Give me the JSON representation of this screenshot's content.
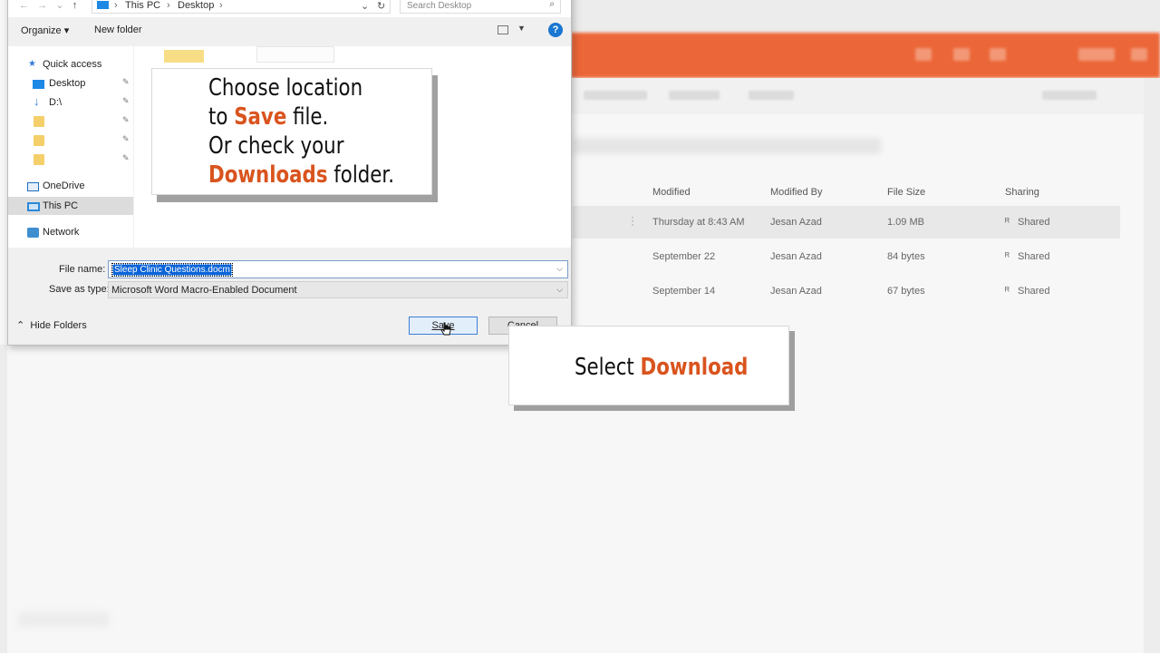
{
  "dialog": {
    "path": [
      "This PC",
      "Desktop"
    ],
    "search_placeholder": "Search Desktop",
    "toolbar": {
      "organize": "Organize ▾",
      "new_folder": "New folder"
    },
    "nav": {
      "quick_access": "Quick access",
      "desktop": "Desktop",
      "d_drive": "D:\\",
      "onedrive": "OneDrive",
      "this_pc": "This PC",
      "network": "Network"
    },
    "file_name_label": "File name:",
    "file_name_value": "Sleep Clinic Questions.docm",
    "save_type_label": "Save as type:",
    "save_type_value": "Microsoft Word Macro-Enabled Document",
    "hide_folders": "Hide Folders",
    "save_button": "Save",
    "cancel_button": "Cancel"
  },
  "table": {
    "headers": {
      "modified": "Modified",
      "modified_by": "Modified By",
      "file_size": "File Size",
      "sharing": "Sharing"
    },
    "rows": [
      {
        "modified": "Thursday at 8:43 AM",
        "modified_by": "Jesan Azad",
        "file_size": "1.09 MB",
        "sharing": "Shared"
      },
      {
        "modified": "September 22",
        "modified_by": "Jesan Azad",
        "file_size": "84 bytes",
        "sharing": "Shared"
      },
      {
        "modified": "September 14",
        "modified_by": "Jesan Azad",
        "file_size": "67 bytes",
        "sharing": "Shared"
      }
    ]
  },
  "callout1": {
    "line1": "Choose location",
    "line2_a": "to ",
    "line2_b": "Save",
    "line2_c": " file.",
    "line3": "Or check your",
    "line4_a": "Downloads",
    "line4_b": " folder."
  },
  "callout2": {
    "a": "Select ",
    "b": "Download"
  },
  "colors": {
    "accent_orange": "#d9541e",
    "selection_blue": "#0a64d8",
    "brand_orange": "#eb5a28"
  }
}
